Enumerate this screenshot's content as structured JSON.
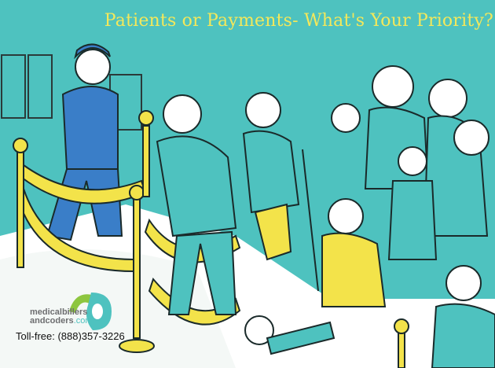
{
  "headline": "Patients or Payments- What's Your Priority?",
  "logo": {
    "line1": "medicalbillers",
    "line2": "andcoders",
    "suffix": ".com"
  },
  "toll_free": "Toll-free: (888)357-3226",
  "colors": {
    "background": "#4ec2bf",
    "headline": "#f4e85a",
    "rope": "#f3e34a",
    "floor": "#ffffff",
    "logo_green": "#8dc63f",
    "logo_teal": "#4ec2bf"
  }
}
